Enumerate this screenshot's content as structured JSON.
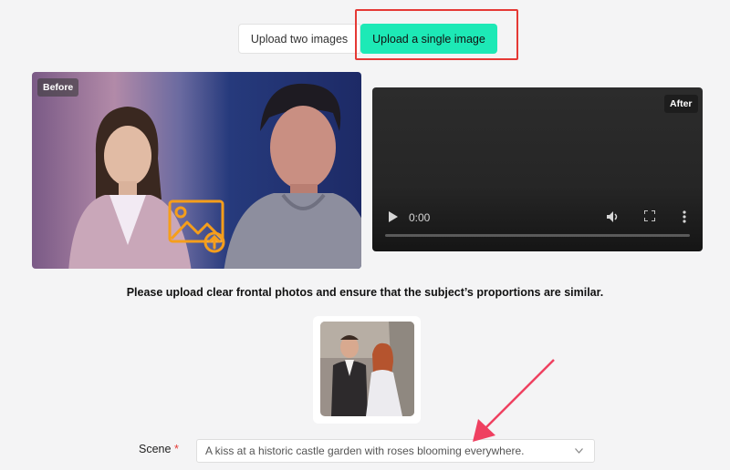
{
  "tabs": {
    "two_images": "Upload two images",
    "single_image": "Upload a single image"
  },
  "before": {
    "badge": "Before"
  },
  "after": {
    "badge": "After"
  },
  "video": {
    "time": "0:00"
  },
  "instructions": "Please upload clear frontal photos and ensure that the subject’s proportions are similar.",
  "scene": {
    "label": "Scene",
    "required_mark": "*",
    "value": "A kiss at a historic castle garden with roses blooming everywhere."
  },
  "colors": {
    "accent": "#1de9b6",
    "highlight": "#e53935",
    "upload_icon": "#f59e1b"
  },
  "icons": [
    "image-upload-icon",
    "play-icon",
    "volume-icon",
    "fullscreen-icon",
    "more-icon",
    "chevron-down-icon"
  ]
}
